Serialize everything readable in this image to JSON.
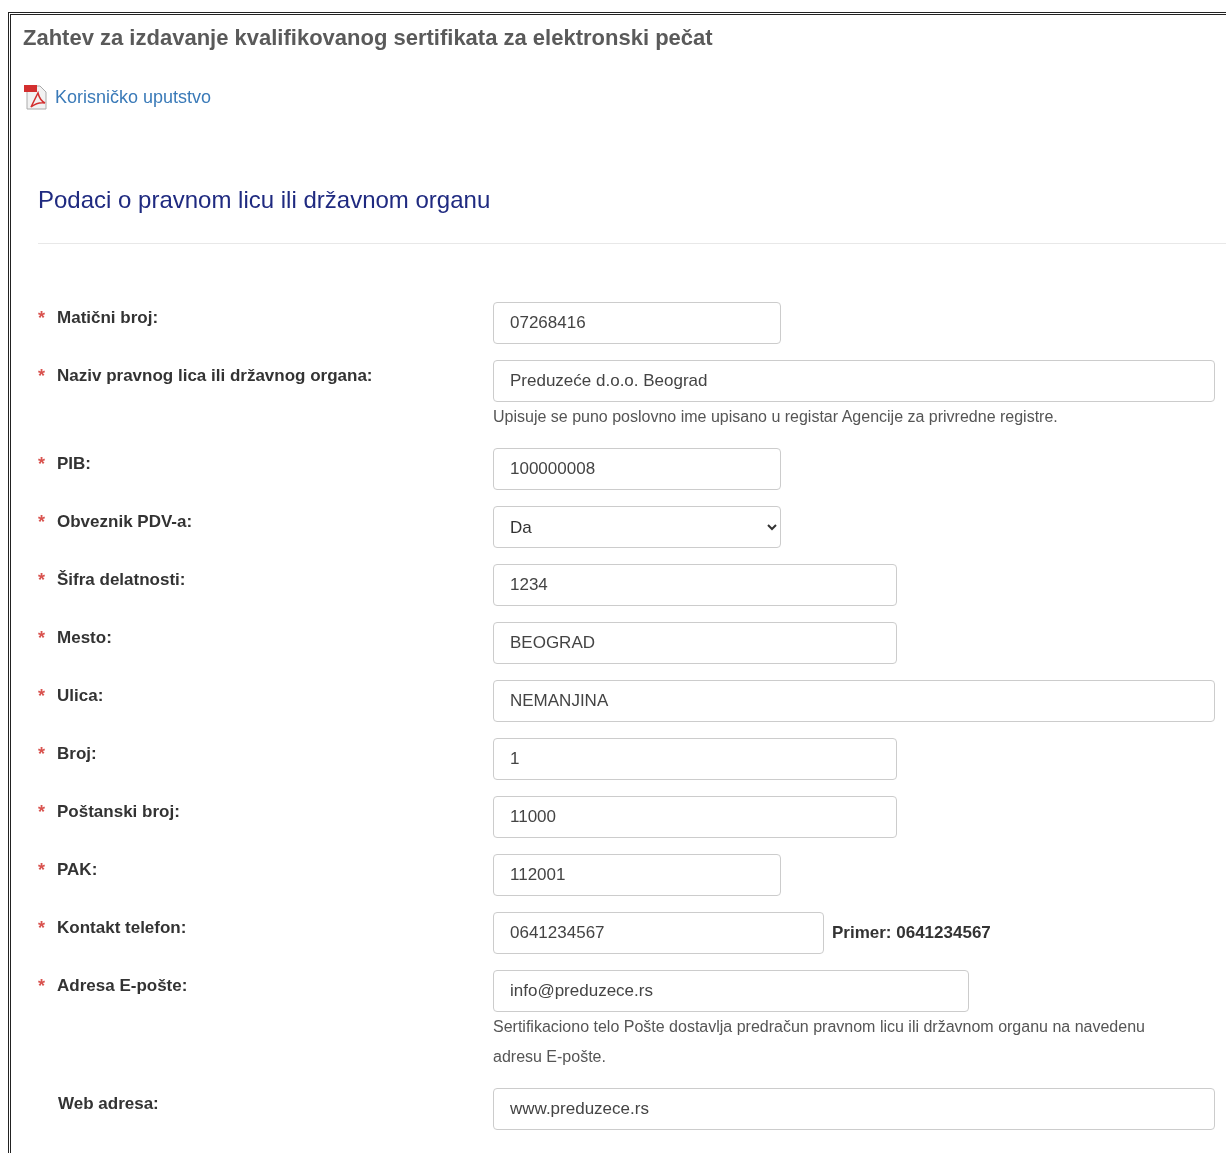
{
  "title": "Zahtev za izdavanje kvalifikovanog sertifikata za elektronski pečat",
  "manual_link": {
    "label": "Korisničko uputstvo"
  },
  "section": {
    "heading": "Podaci o pravnom licu ili državnom organu"
  },
  "fields": [
    {
      "kind": "text",
      "required_mark": "*",
      "label": "Matični broj:",
      "value": "07268416"
    },
    {
      "kind": "text",
      "required_mark": "*",
      "label": "Naziv pravnog lica ili državnog organa:",
      "value": "Preduzeće d.o.o. Beograd",
      "hint": "Upisuje se puno poslovno ime upisano u registar Agencije za privredne registre."
    },
    {
      "kind": "text",
      "required_mark": "*",
      "label": "PIB:",
      "value": "100000008"
    },
    {
      "kind": "select",
      "required_mark": "*",
      "label": "Obveznik PDV-a:",
      "value": "Da"
    },
    {
      "kind": "text",
      "required_mark": "*",
      "label": "Šifra delatnosti:",
      "value": "1234"
    },
    {
      "kind": "text",
      "required_mark": "*",
      "label": "Mesto:",
      "value": "BEOGRAD"
    },
    {
      "kind": "text",
      "required_mark": "*",
      "label": "Ulica:",
      "value": "NEMANJINA"
    },
    {
      "kind": "text",
      "required_mark": "*",
      "label": "Broj:",
      "value": "1"
    },
    {
      "kind": "text",
      "required_mark": "*",
      "label": "Poštanski broj:",
      "value": "11000"
    },
    {
      "kind": "text",
      "required_mark": "*",
      "label": "PAK:",
      "value": "112001"
    },
    {
      "kind": "text",
      "required_mark": "*",
      "label": "Kontakt telefon:",
      "value": "0641234567",
      "example": "Primer: 0641234567"
    },
    {
      "kind": "text",
      "required_mark": "*",
      "label": "Adresa E-pošte:",
      "value": "info@preduzece.rs",
      "hint": "Sertifikaciono telo Pošte dostavlja predračun pravnom licu ili državnom organu na navedenu adresu E-pošte."
    },
    {
      "kind": "text",
      "label": "Web adresa:",
      "value": "www.preduzece.rs"
    }
  ]
}
